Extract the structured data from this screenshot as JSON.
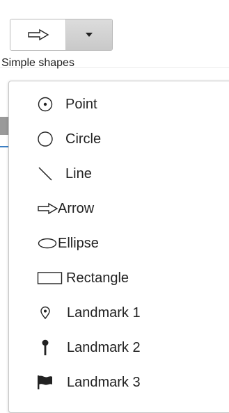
{
  "toolbar": {
    "selected_shape_icon": "arrow-icon",
    "dropdown_icon": "caret-down-icon",
    "caption": "Simple shapes"
  },
  "menu": {
    "items": [
      {
        "label": "Point",
        "icon": "point-icon"
      },
      {
        "label": "Circle",
        "icon": "circle-icon"
      },
      {
        "label": "Line",
        "icon": "line-icon"
      },
      {
        "label": "Arrow",
        "icon": "arrow-icon"
      },
      {
        "label": "Ellipse",
        "icon": "ellipse-icon"
      },
      {
        "label": "Rectangle",
        "icon": "rectangle-icon"
      },
      {
        "label": "Landmark 1",
        "icon": "landmark-pin-icon"
      },
      {
        "label": "Landmark 2",
        "icon": "landmark-pushpin-icon"
      },
      {
        "label": "Landmark 3",
        "icon": "landmark-flag-icon"
      }
    ]
  },
  "colors": {
    "accent": "#3b7fc4",
    "text": "#222222",
    "border": "#c6c6c6"
  }
}
